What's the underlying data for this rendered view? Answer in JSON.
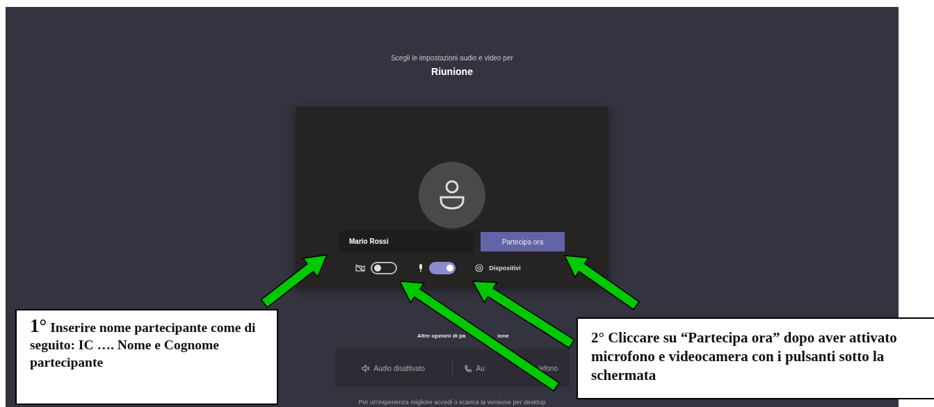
{
  "prejoin": {
    "subtitle": "Scegli le impostazioni audio e video per",
    "meeting_title": "Riunione",
    "name_field": {
      "value": "Mario Rossi"
    },
    "join_button": "Partecipa ora",
    "toggles": [
      {
        "kind": "camera",
        "on": false
      },
      {
        "kind": "mic",
        "on": true
      }
    ],
    "devices_label": "Dispositivi",
    "other_options_title": [
      "Altre opzioni di pa",
      "ione"
    ],
    "other_options": [
      {
        "kind": "audio-off",
        "label": [
          "Audio disattivato"
        ]
      },
      {
        "kind": "phone",
        "label": [
          "Au",
          "lefono"
        ]
      }
    ],
    "footer_note": "Per un'esperienza migliore accedi o scarica la versione per desktop"
  },
  "callouts": [
    {
      "number": "1°",
      "text": "Inserire nome partecipante come di seguito: IC …. Nome e Cognome partecipante"
    },
    {
      "text": "2° Cliccare su “Partecipa ora” dopo aver attivato microfono e videocamera con i pulsanti sotto la schermata"
    }
  ]
}
